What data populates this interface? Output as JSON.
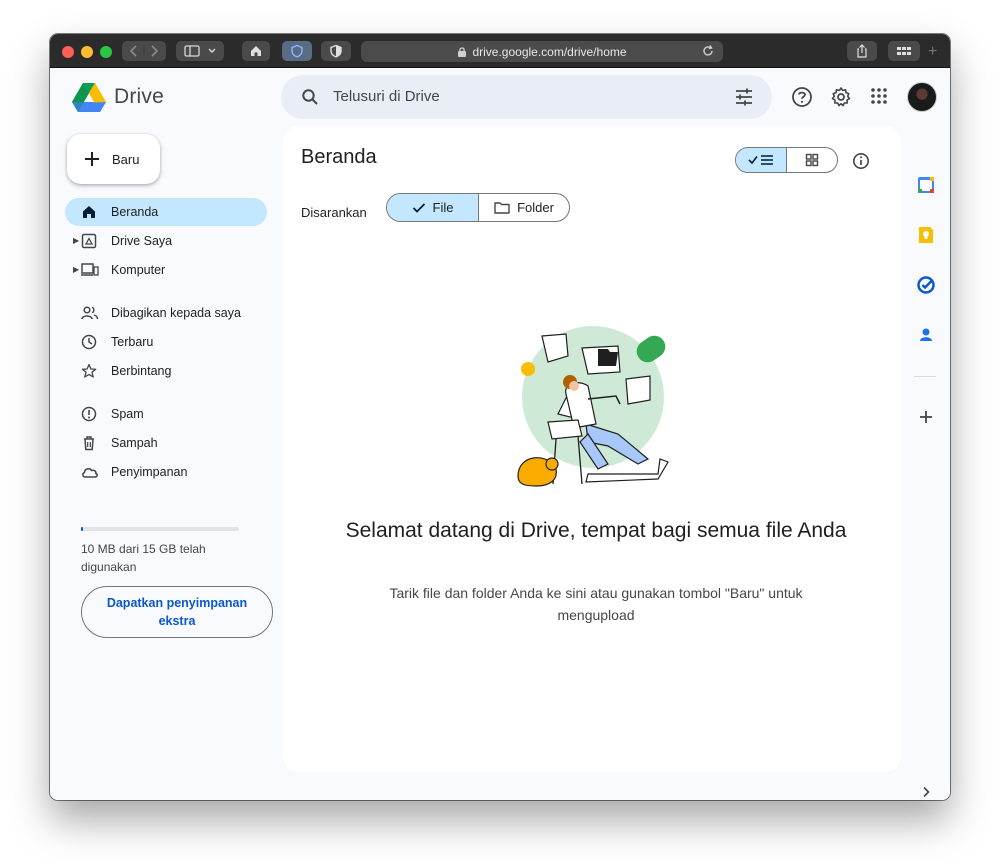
{
  "browser": {
    "url": "drive.google.com/drive/home"
  },
  "app": {
    "name": "Drive",
    "search_placeholder": "Telusuri di Drive"
  },
  "sidebar": {
    "new_label": "Baru",
    "items": [
      {
        "label": "Beranda",
        "icon": "home-icon",
        "active": true
      },
      {
        "label": "Drive Saya",
        "icon": "my-drive-icon",
        "expandable": true
      },
      {
        "label": "Komputer",
        "icon": "computer-icon",
        "expandable": true
      },
      {
        "label": "Dibagikan kepada saya",
        "icon": "shared-icon"
      },
      {
        "label": "Terbaru",
        "icon": "clock-icon"
      },
      {
        "label": "Berbintang",
        "icon": "star-icon"
      },
      {
        "label": "Spam",
        "icon": "spam-icon"
      },
      {
        "label": "Sampah",
        "icon": "trash-icon"
      },
      {
        "label": "Penyimpanan",
        "icon": "cloud-icon"
      }
    ],
    "quota_text": "10 MB dari 15 GB telah digunakan",
    "quota_used_fraction": 0.0007,
    "storage_button": "Dapatkan penyimpanan ekstra"
  },
  "main": {
    "title": "Beranda",
    "suggested_label": "Disarankan",
    "chips": {
      "file": "File",
      "folder": "Folder"
    },
    "welcome_title": "Selamat datang di Drive, tempat bagi semua file Anda",
    "welcome_subtitle": "Tarik file dan folder Anda ke sini atau gunakan tombol \"Baru\" untuk mengupload"
  },
  "colors": {
    "accent": "#0b57d0",
    "selected": "#c2e7ff",
    "surface": "#f8fafd"
  }
}
